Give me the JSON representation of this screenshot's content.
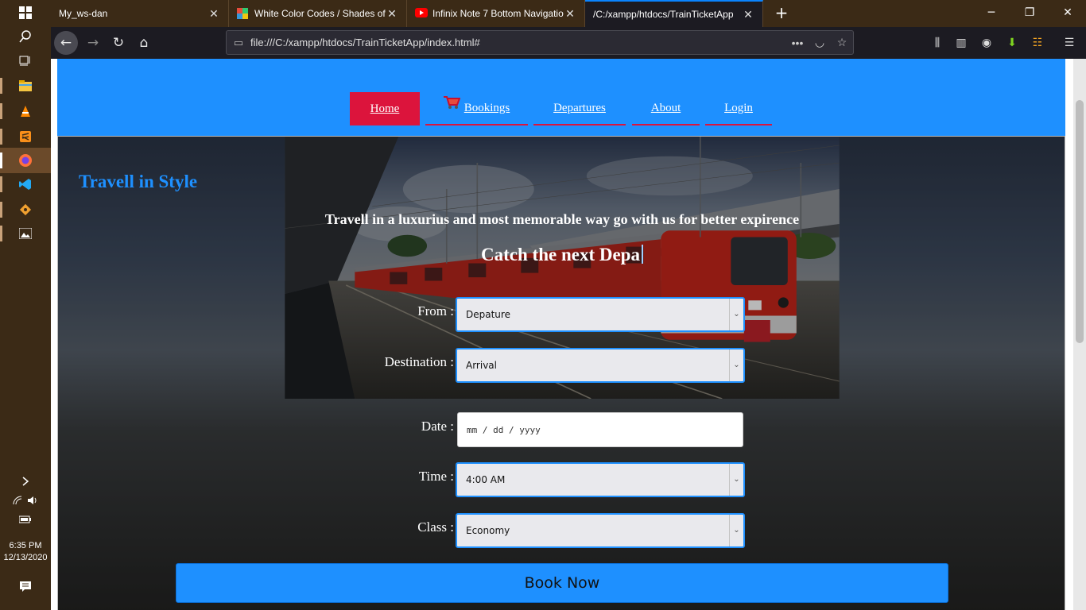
{
  "taskbar": {
    "time": "6:35 PM",
    "date": "12/13/2020"
  },
  "browser": {
    "tabs": [
      {
        "title": "My_ws-dan"
      },
      {
        "title": "White Color Codes / Shades of"
      },
      {
        "title": "Infinix Note 7 Bottom Navigatio"
      },
      {
        "title": "/C:/xampp/htdocs/TrainTicketApp"
      }
    ],
    "url": "file:///C:/xampp/htdocs/TrainTicketApp/index.html#"
  },
  "site": {
    "nav": [
      {
        "label": "Home"
      },
      {
        "label": "Bookings"
      },
      {
        "label": "Departures"
      },
      {
        "label": "About"
      },
      {
        "label": "Login"
      }
    ],
    "brand": "Travell in Style",
    "tagline": "Travell in a luxurius and most memorable way go with us for better expirence",
    "typing_text": "Catch the next Depa",
    "form": {
      "from_label": "From :",
      "from_value": "Depature",
      "destination_label": "Destination :",
      "destination_value": "Arrival",
      "date_label": "Date :",
      "date_placeholder": "mm / dd / yyyy",
      "time_label": "Time :",
      "time_value": "4:00 AM",
      "class_label": "Class :",
      "class_value": "Economy",
      "submit_label": "Book Now"
    }
  },
  "colors": {
    "header_blue": "#1e90ff",
    "active_red": "#dc143c",
    "taskbar_brown": "#3b2a16"
  }
}
